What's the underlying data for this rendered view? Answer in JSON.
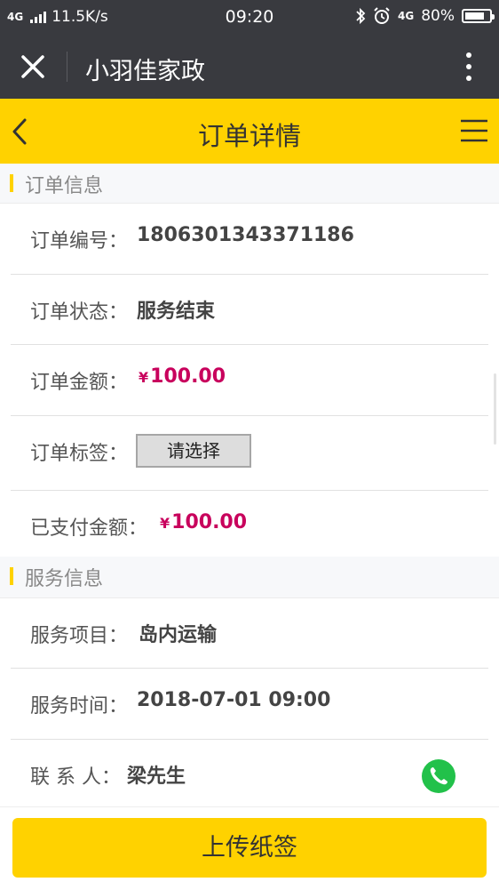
{
  "status_bar": {
    "network": "4G",
    "speed": "11.5K/s",
    "time": "09:20",
    "net_right": "4G",
    "battery": "80%",
    "battery_level": 0.8
  },
  "wechat_bar": {
    "title": "小羽佳家政"
  },
  "header": {
    "title": "订单详情"
  },
  "order_section": {
    "title": "订单信息",
    "order_no_label": "订单编号：",
    "order_no": "1806301343371186",
    "status_label": "订单状态：",
    "status": "服务结束",
    "amount_label": "订单金额：",
    "amount_currency": "¥",
    "amount": "100.00",
    "tag_label": "订单标签：",
    "tag_select": "请选择",
    "paid_label": "已支付金额：",
    "paid_currency": "¥",
    "paid": "100.00"
  },
  "service_section": {
    "title": "服务信息",
    "item_label": "服务项目：",
    "item": "岛内运输",
    "time_label": "服务时间：",
    "time": "2018-07-01 09:00",
    "contact_label": "联 系 人：",
    "contact": "梁先生"
  },
  "footer": {
    "upload_button": "上传纸签"
  },
  "colors": {
    "accent": "#ffd200",
    "money": "#c8005c",
    "dark_bar": "#393a3f",
    "phone": "#22c14a"
  }
}
